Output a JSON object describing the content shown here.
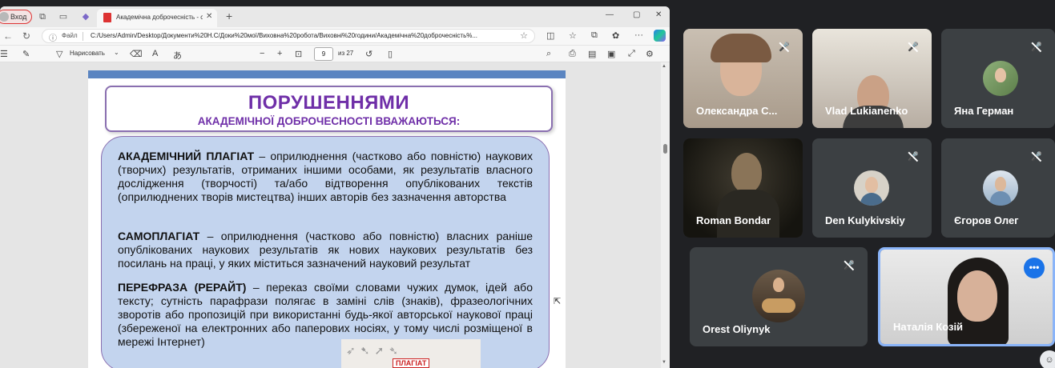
{
  "browser": {
    "profile_label": "Вход",
    "tab_title": "Академічна доброчесність - суч",
    "new_tab_icon": "plus-icon",
    "address": {
      "file_label": "Файл",
      "url": "C:/Users/Admin/Desktop/Документи%20Н.С/Доки%20мої/Виховна%20робота/Виховні%20години/Академічна%20доброчесність%..."
    },
    "pdf_toolbar": {
      "draw_label": "Нарисовать",
      "page_current": "9",
      "page_of": "из 27"
    }
  },
  "slide": {
    "title_main": "ПОРУШЕННЯМИ",
    "title_sub": "АКАДЕМІЧНОЇ ДОБРОЧЕСНОСТІ ВВАЖАЮТЬСЯ:",
    "paragraphs": [
      {
        "term": "АКАДЕМІЧНИЙ ПЛАГІАТ",
        "text": " – оприлюднення (частково або повністю) наукових (творчих) результатів, отриманих іншими особами, як результатів власного дослідження (творчості) та/або відтворення опублікованих текстів (оприлюднених творів мистецтва) інших авторів без зазначення авторства"
      },
      {
        "term": "САМОПЛАГІАТ",
        "text": " – оприлюднення (частково або повністю) власних раніше опублікованих наукових результатів як нових наукових результатів без посилань на праці, у яких міститься зазначений науковий результат"
      },
      {
        "term": "ПЕРЕФРАЗА (РЕРАЙТ)",
        "text": " – переказ своїми словами чужих думок, ідей або тексту; сутність парафрази полягає в заміні слів (знаків), фразеологічних зворотів або пропозицій при використанні будь-якої авторської наукової праці (збереженої на електронних або паперових носіях, у тому числі розміщеної в мережі Інтернет)"
      }
    ],
    "image_label": "ПЛАГІАТ"
  },
  "participants": [
    {
      "name": "Олександра С...",
      "muted": true,
      "mode": "video"
    },
    {
      "name": "Vlad Lukianenko",
      "muted": true,
      "mode": "video"
    },
    {
      "name": "Яна Герман",
      "muted": true,
      "mode": "avatar"
    },
    {
      "name": "Roman Bondar",
      "muted": false,
      "mode": "video"
    },
    {
      "name": "Den Kulykivskiy",
      "muted": true,
      "mode": "avatar"
    },
    {
      "name": "Єгоров Олег",
      "muted": true,
      "mode": "avatar"
    },
    {
      "name": "Orest Oliynyk",
      "muted": true,
      "mode": "avatar"
    },
    {
      "name": "Наталія Козій",
      "muted": false,
      "mode": "video",
      "speaking": true
    }
  ],
  "colors": {
    "slide_title": "#6f2fa8",
    "slide_box": "#c3d4ee",
    "meet_tile": "#3c4043",
    "speaking_border": "#8ab4f8"
  }
}
